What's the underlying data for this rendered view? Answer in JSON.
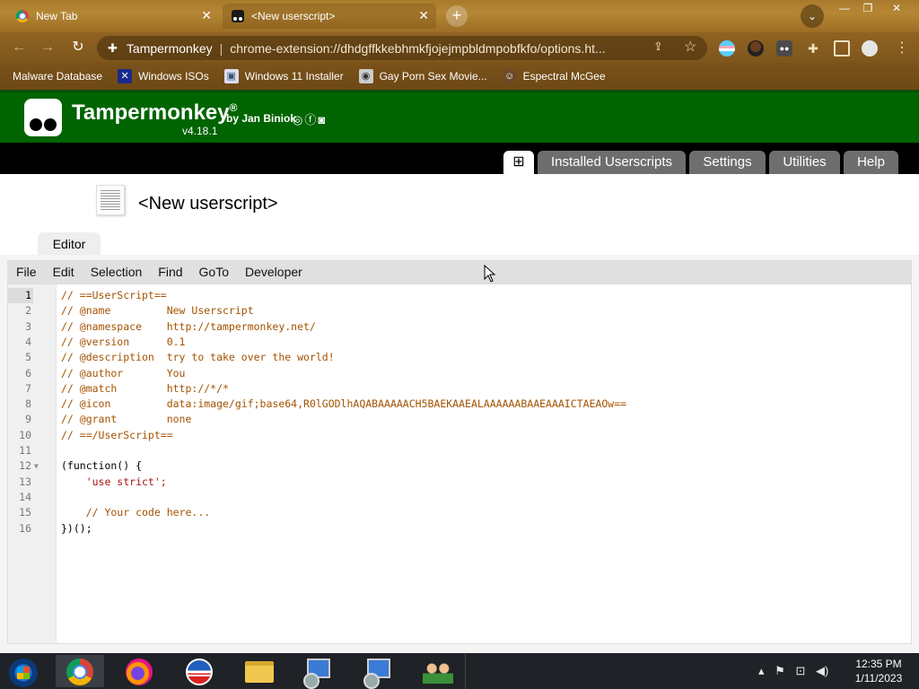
{
  "browser": {
    "tabs": [
      {
        "title": "New Tab",
        "active": false
      },
      {
        "title": "<New userscript>",
        "active": true
      }
    ],
    "new_tab_label": "+",
    "omnibox": {
      "site": "Tampermonkey",
      "url": "chrome-extension://dhdgffkkebhmkfjojejmpbldmpobfkfo/options.ht..."
    },
    "bookmarks": [
      {
        "label": "Malware Database"
      },
      {
        "label": "Windows ISOs"
      },
      {
        "label": "Windows 11 Installer"
      },
      {
        "label": "Gay Porn Sex Movie..."
      },
      {
        "label": "Espectral McGee"
      }
    ]
  },
  "tampermonkey": {
    "brand": "Tampermonkey",
    "registered": "®",
    "by": "by Jan Biniok",
    "social": "◎ⓕ◙",
    "version": "v4.18.1",
    "nav": {
      "new_script": "⊞",
      "installed": "Installed Userscripts",
      "settings": "Settings",
      "utilities": "Utilities",
      "help": "Help"
    },
    "script_title": "<New userscript>",
    "editor_tab": "Editor",
    "menu": [
      "File",
      "Edit",
      "Selection",
      "Find",
      "GoTo",
      "Developer"
    ],
    "code": [
      {
        "n": "1",
        "text": "// ==UserScript==",
        "type": "comment"
      },
      {
        "n": "2",
        "text": "// @name         New Userscript",
        "type": "comment"
      },
      {
        "n": "3",
        "text": "// @namespace    http://tampermonkey.net/",
        "type": "comment"
      },
      {
        "n": "4",
        "text": "// @version      0.1",
        "type": "comment"
      },
      {
        "n": "5",
        "text": "// @description  try to take over the world!",
        "type": "comment"
      },
      {
        "n": "6",
        "text": "// @author       You",
        "type": "comment"
      },
      {
        "n": "7",
        "text": "// @match        http://*/*",
        "type": "comment"
      },
      {
        "n": "8",
        "text": "// @icon         data:image/gif;base64,R0lGODlhAQABAAAAACH5BAEKAAEALAAAAAABAAEAAAICTAEAOw==",
        "type": "comment"
      },
      {
        "n": "9",
        "text": "// @grant        none",
        "type": "comment"
      },
      {
        "n": "10",
        "text": "// ==/UserScript==",
        "type": "comment"
      },
      {
        "n": "11",
        "text": "",
        "type": "plain"
      },
      {
        "n": "12",
        "text": "(function() {",
        "type": "plain",
        "fold": true
      },
      {
        "n": "13",
        "text": "    'use strict';",
        "type": "string"
      },
      {
        "n": "14",
        "text": "",
        "type": "plain"
      },
      {
        "n": "15",
        "text": "    // Your code here...",
        "type": "comment"
      },
      {
        "n": "16",
        "text": "})();",
        "type": "plain"
      }
    ],
    "active_line": "1",
    "colors": {
      "header_green": "#006400",
      "comment": "#a35200",
      "string": "#aa1111"
    }
  },
  "taskbar": {
    "apps": [
      "start-orb",
      "chrome",
      "firefox",
      "obama-app",
      "file-explorer",
      "installer",
      "installer",
      "users-app"
    ],
    "time": "12:35 PM",
    "date": "1/11/2023"
  }
}
